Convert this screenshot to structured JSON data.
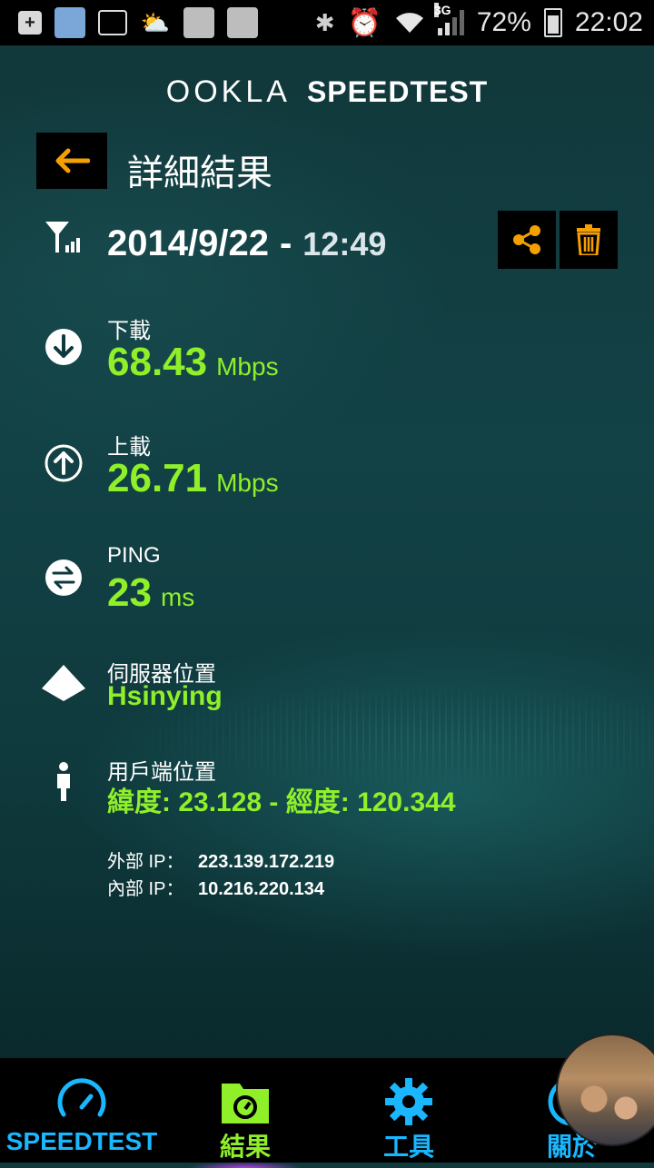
{
  "status_bar": {
    "battery_percent": "72%",
    "time": "22:02",
    "network": "3G"
  },
  "header": {
    "brand_ookla": "OOKLA",
    "brand_speedtest": "SPEEDTEST"
  },
  "page": {
    "title": "詳細結果"
  },
  "result": {
    "date": "2014/9/22",
    "separator": "-",
    "time": "12:49",
    "download": {
      "label": "下載",
      "value": "68.43",
      "unit": "Mbps"
    },
    "upload": {
      "label": "上載",
      "value": "26.71",
      "unit": "Mbps"
    },
    "ping": {
      "label": "PING",
      "value": "23",
      "unit": "ms"
    },
    "server": {
      "label": "伺服器位置",
      "value": "Hsinying"
    },
    "client": {
      "label": "用戶端位置",
      "value": "緯度: 23.128 - 經度: 120.344"
    },
    "external_ip": {
      "label": "外部 IP：",
      "value": "223.139.172.219"
    },
    "internal_ip": {
      "label": "內部 IP：",
      "value": "10.216.220.134"
    }
  },
  "bottom_nav": {
    "items": [
      {
        "label": "SPEEDTEST",
        "icon": "speedometer-icon"
      },
      {
        "label": "結果",
        "icon": "folder-gauge-icon"
      },
      {
        "label": "工具",
        "icon": "gear-icon"
      },
      {
        "label": "關於",
        "icon": "info-icon"
      }
    ],
    "active_index": 1
  },
  "colors": {
    "accent_green": "#8ff02a",
    "accent_orange": "#f5a000",
    "nav_blue": "#1ab7ff"
  }
}
